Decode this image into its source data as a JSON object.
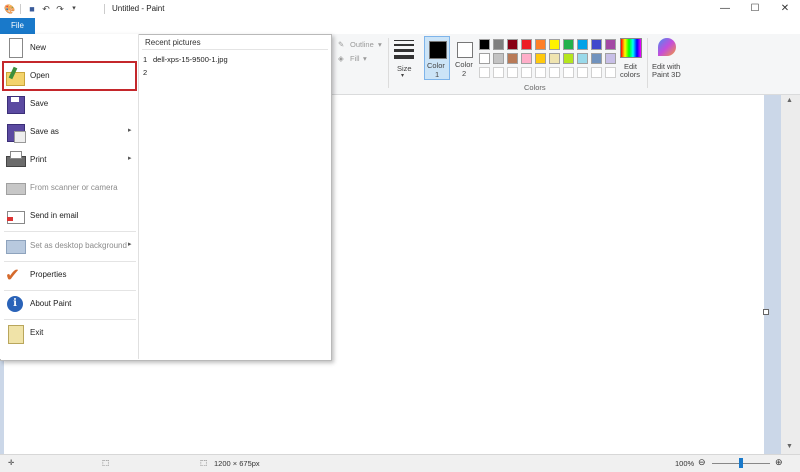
{
  "window": {
    "title": "Untitled - Paint"
  },
  "tabs": {
    "file": "File"
  },
  "menu": {
    "items": [
      {
        "label": "New"
      },
      {
        "label": "Open"
      },
      {
        "label": "Save"
      },
      {
        "label": "Save as"
      },
      {
        "label": "Print"
      },
      {
        "label": "From scanner or camera"
      },
      {
        "label": "Send in email"
      },
      {
        "label": "Set as desktop background"
      },
      {
        "label": "Properties"
      },
      {
        "label": "About Paint"
      },
      {
        "label": "Exit"
      }
    ],
    "recent_title": "Recent pictures",
    "recent": [
      {
        "num": "1",
        "name": "dell-xps-15-9500-1.jpg"
      },
      {
        "num": "2",
        "name": ""
      }
    ]
  },
  "ribbon": {
    "outline": "Outline",
    "fill": "Fill",
    "size": "Size",
    "color1_a": "Color",
    "color1_b": "1",
    "color2_a": "Color",
    "color2_b": "2",
    "edit_colors_a": "Edit",
    "edit_colors_b": "colors",
    "paint3d_a": "Edit with",
    "paint3d_b": "Paint 3D",
    "colors_group": "Colors",
    "palette_row1": [
      "#000000",
      "#7f7f7f",
      "#880015",
      "#ed1c24",
      "#ff7f27",
      "#fff200",
      "#22b14c",
      "#00a2e8",
      "#3f48cc",
      "#a349a4"
    ],
    "palette_row2": [
      "#ffffff",
      "#c3c3c3",
      "#b97a57",
      "#ffaec9",
      "#ffc90e",
      "#efe4b0",
      "#b5e61d",
      "#99d9ea",
      "#7092be",
      "#c8bfe7"
    ]
  },
  "status": {
    "dimensions": "1200 × 675px",
    "zoom": "100%"
  }
}
